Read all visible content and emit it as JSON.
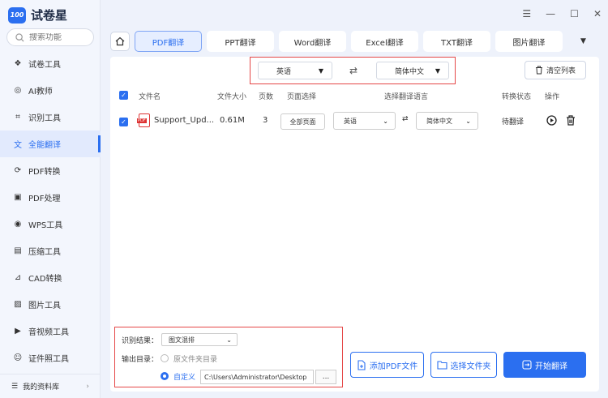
{
  "app": {
    "logo_badge": "100",
    "name": "试卷星"
  },
  "search": {
    "placeholder": "搜索功能"
  },
  "sidebar": {
    "items": [
      {
        "label": "试卷工具",
        "icon": "layers-icon"
      },
      {
        "label": "AI教师",
        "icon": "ai-icon"
      },
      {
        "label": "识别工具",
        "icon": "scan-icon"
      },
      {
        "label": "全能翻译",
        "icon": "translate-icon",
        "active": true
      },
      {
        "label": "PDF转换",
        "icon": "convert-icon"
      },
      {
        "label": "PDF处理",
        "icon": "pdf-process-icon"
      },
      {
        "label": "WPS工具",
        "icon": "wps-icon"
      },
      {
        "label": "压缩工具",
        "icon": "compress-icon"
      },
      {
        "label": "CAD转换",
        "icon": "cad-icon"
      },
      {
        "label": "图片工具",
        "icon": "image-icon"
      },
      {
        "label": "音视频工具",
        "icon": "media-icon"
      },
      {
        "label": "证件照工具",
        "icon": "id-photo-icon"
      }
    ],
    "library": "我的资料库"
  },
  "tabs": [
    "PDF翻译",
    "PPT翻译",
    "Word翻译",
    "Excel翻译",
    "TXT翻译",
    "图片翻译"
  ],
  "active_tab": "PDF翻译",
  "lang_bar": {
    "source": "英语",
    "target": "简体中文",
    "clear": "清空列表"
  },
  "table": {
    "headers": {
      "name": "文件名",
      "size": "文件大小",
      "pages": "页数",
      "page_select": "页面选择",
      "lang": "选择翻译语言",
      "status": "转换状态",
      "ops": "操作"
    },
    "rows": [
      {
        "name": "Support_Upd...",
        "size": "0.61M",
        "pages": "3",
        "page_select": "全部页面",
        "source": "英语",
        "target": "简体中文",
        "status": "待翻译"
      }
    ]
  },
  "output": {
    "recog_label": "识别结果：",
    "recog_value": "图文混排",
    "dir_label": "输出目录：",
    "opt_original": "原文件夹目录",
    "opt_custom": "自定义",
    "path": "C:\\Users\\Administrator\\Desktop",
    "browse": "..."
  },
  "actions": {
    "add_pdf": "添加PDF文件",
    "select_folder": "选择文件夹",
    "start": "开始翻译"
  },
  "colors": {
    "accent": "#2b6ff0",
    "highlight": "#e54848"
  }
}
